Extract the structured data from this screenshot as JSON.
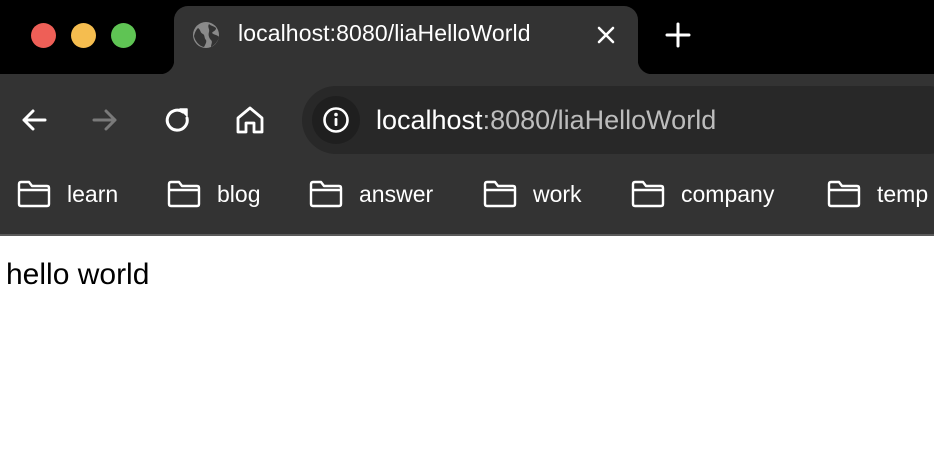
{
  "window": {
    "traffic_lights": {
      "close": "#ee5f57",
      "minimize": "#f5bd4f",
      "zoom": "#5fc454"
    }
  },
  "tab": {
    "favicon": "globe-icon",
    "title": "localhost:8080/liaHelloWorld",
    "close_icon": "close-icon"
  },
  "new_tab_icon": "plus-icon",
  "toolbar": {
    "back_icon": "arrow-left-icon",
    "forward_icon": "arrow-right-icon",
    "reload_icon": "reload-icon",
    "home_icon": "home-icon",
    "site_info_icon": "info-icon",
    "url_host": "localhost",
    "url_rest": ":8080/liaHelloWorld"
  },
  "bookmarks": [
    {
      "label": "learn",
      "icon": "folder-icon"
    },
    {
      "label": "blog",
      "icon": "folder-icon"
    },
    {
      "label": "answer",
      "icon": "folder-icon"
    },
    {
      "label": "work",
      "icon": "folder-icon"
    },
    {
      "label": "company",
      "icon": "folder-icon"
    },
    {
      "label": "temp",
      "icon": "folder-icon"
    }
  ],
  "page": {
    "text": "hello world"
  },
  "colors": {
    "tabstrip": "#000000",
    "toolbar": "#333333",
    "omnibox": "#282828",
    "page_background": "#ffffff"
  }
}
